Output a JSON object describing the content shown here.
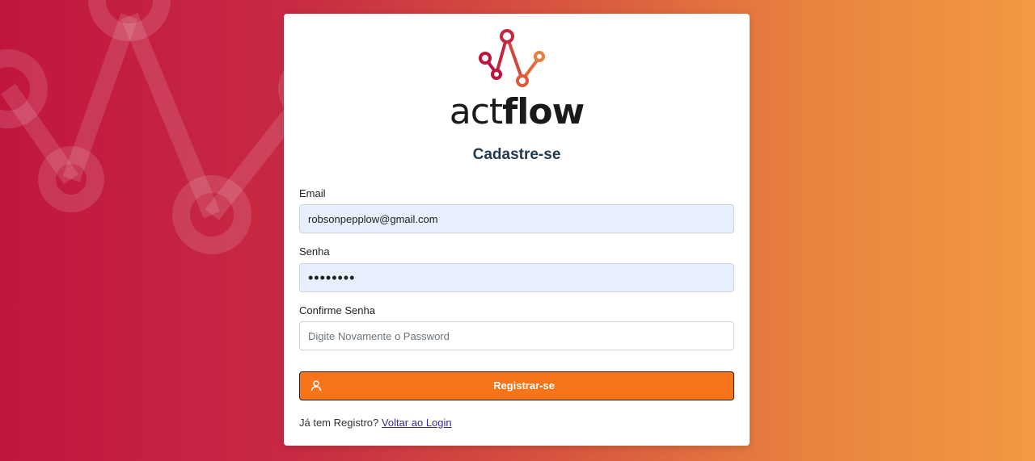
{
  "brand": {
    "name_light": "act",
    "name_bold": "flow",
    "colors": {
      "primary_red": "#c0163e",
      "accent_orange": "#f7751a",
      "background_right": "#f29a42"
    }
  },
  "form": {
    "title": "Cadastre-se",
    "email": {
      "label": "Email",
      "value": "robsonpepplow@gmail.com"
    },
    "password": {
      "label": "Senha",
      "value": "••••••••"
    },
    "confirm_password": {
      "label": "Confirme Senha",
      "placeholder": "Digite Novamente o Password",
      "value": ""
    },
    "submit": {
      "label": "Registrar-se",
      "icon": "user-icon"
    }
  },
  "footer": {
    "prompt": "Já tem Registro?",
    "link_label": "Voltar ao Login"
  }
}
